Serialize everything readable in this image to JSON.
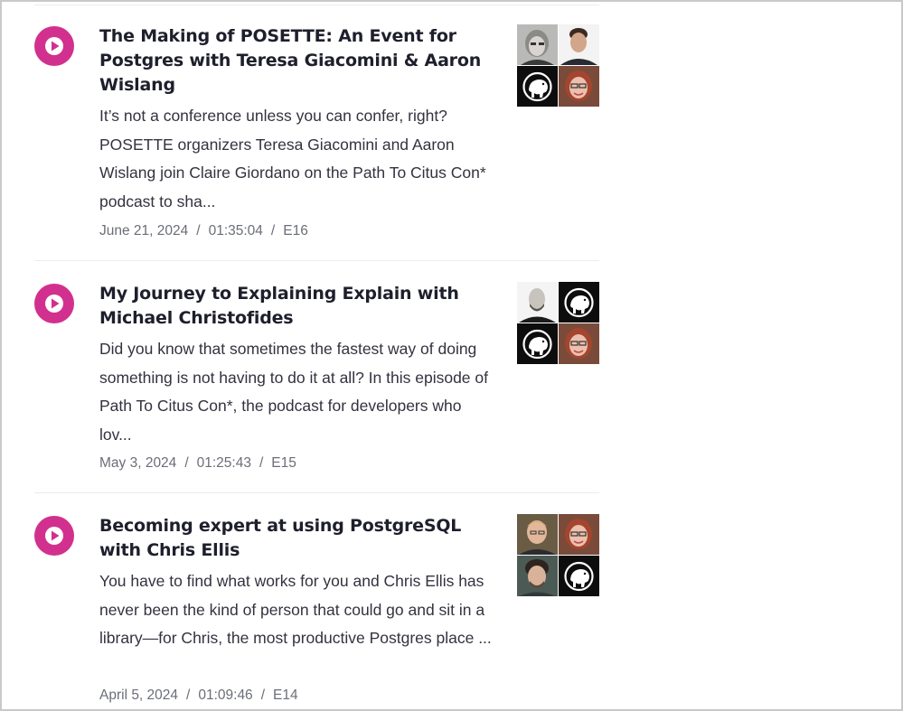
{
  "episodes": [
    {
      "title": "The Making of POSETTE: An Event for Postgres with Teresa Giacomini & Aaron Wislang",
      "description": "It’s not a conference unless you can confer, right? POSETTE organizers Teresa Giacomini and Aaron Wislang join Claire Giordano on the Path To Citus Con* podcast to sha...",
      "date": "June 21, 2024",
      "duration": "01:35:04",
      "episode": "E16",
      "separator": "/",
      "play_icon": "play-icon",
      "thumbnails": [
        "portrait-woman-glasses",
        "portrait-man-dark-hair",
        "postgres-elephant-logo",
        "portrait-woman-red-hair"
      ]
    },
    {
      "title": "My Journey to Explaining Explain with Michael Christofides",
      "description": "Did you know that sometimes the fastest way of doing something is not having to do it at all? In this episode of Path To Citus Con*, the podcast for developers who lov...",
      "date": "May 3, 2024",
      "duration": "01:25:43",
      "episode": "E15",
      "separator": "/",
      "play_icon": "play-icon",
      "thumbnails": [
        "portrait-bald-man",
        "postgres-elephant-logo",
        "postgres-elephant-logo",
        "portrait-woman-red-hair"
      ]
    },
    {
      "title": "Becoming expert at using PostgreSQL with Chris Ellis",
      "description": "You have to find what works for you and Chris Ellis has never been the kind of person that could go and sit in a library—for Chris, the most productive Postgres place ...",
      "date": "April 5, 2024",
      "duration": "01:09:46",
      "episode": "E14",
      "separator": "/",
      "play_icon": "play-icon",
      "thumbnails": [
        "portrait-blond-man",
        "portrait-woman-red-hair",
        "portrait-man-curly-hair",
        "postgres-elephant-logo"
      ]
    }
  ],
  "colors": {
    "accent": "#d2308e",
    "title": "#1e1f2c",
    "body": "#333340",
    "meta": "#6b6e78",
    "divider": "#ececec"
  }
}
